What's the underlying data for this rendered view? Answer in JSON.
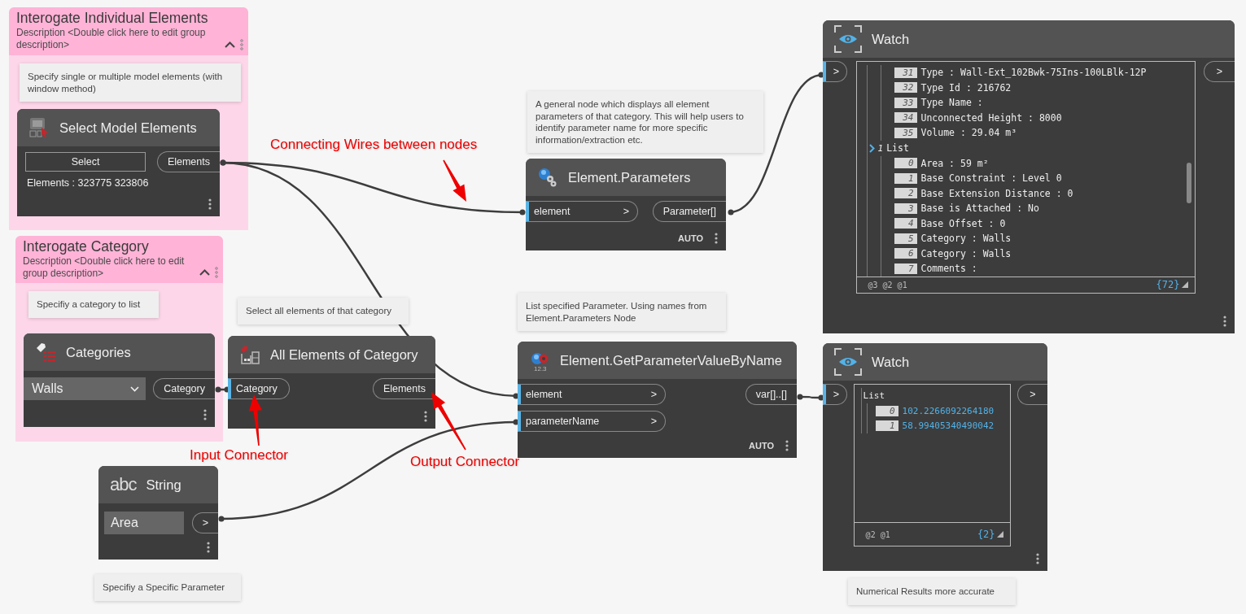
{
  "groups": [
    {
      "title": "Interogate Individual Elements",
      "description": "Description <Double click here to edit group description>"
    },
    {
      "title": "Interogate Category",
      "description": "Description <Double click here to edit group description>"
    }
  ],
  "notes": [
    {
      "text": "Specify single or multiple model elements (with window method)"
    },
    {
      "text": "Specifiy a category to list"
    },
    {
      "text": "Select all elements of that category"
    },
    {
      "text": "A general node which displays all element parameters of that category. This will help users to identify parameter name for more specific information/extraction etc."
    },
    {
      "text": "List specified Parameter. Using names from Element.Parameters Node"
    },
    {
      "text": "Specifiy a Specific Parameter"
    },
    {
      "text": "Numerical Results more accurate"
    }
  ],
  "nodes": [
    {
      "kind": "select",
      "title": "Select Model Elements",
      "button": "Select",
      "value": "Elements : 323775 323806",
      "outputs": [
        {
          "label": "Elements"
        }
      ]
    },
    {
      "kind": "dropdown",
      "title": "Categories",
      "value": "Walls",
      "outputs": [
        {
          "label": "Category"
        }
      ]
    },
    {
      "kind": "function",
      "title": "All Elements of Category",
      "inputs": [
        {
          "label": "Category"
        }
      ],
      "outputs": [
        {
          "label": "Elements"
        }
      ]
    },
    {
      "kind": "function",
      "title": "Element.Parameters",
      "inputs": [
        {
          "label": "element",
          "arrow": ">"
        }
      ],
      "outputs": [
        {
          "label": "Parameter[]"
        }
      ],
      "lacing": "AUTO"
    },
    {
      "kind": "function",
      "title": "Element.GetParameterValueByName",
      "icon_text": "12.3",
      "inputs": [
        {
          "label": "element",
          "arrow": ">"
        },
        {
          "label": "parameterName",
          "arrow": ">"
        }
      ],
      "outputs": [
        {
          "label": "var[]..[]"
        }
      ],
      "lacing": "AUTO"
    },
    {
      "kind": "string",
      "icon_text": "abc",
      "title": "String",
      "value": "Area",
      "outputs": [
        {
          "label": ">"
        }
      ]
    },
    {
      "kind": "watch",
      "title": "Watch",
      "inputs": [
        {
          "label": ">"
        }
      ],
      "outputs": [
        {
          "label": ">"
        }
      ],
      "lists": [
        {
          "items": [
            {
              "index": "31",
              "text": "Type : Wall-Ext_102Bwk-75Ins-100LBlk-12P",
              "kind": "text"
            },
            {
              "index": "32",
              "text": "Type Id : 216762",
              "kind": "text"
            },
            {
              "index": "33",
              "text": "Type Name :",
              "kind": "text"
            },
            {
              "index": "34",
              "text": "Unconnected Height : 8000",
              "kind": "text"
            },
            {
              "index": "35",
              "text": "Volume : 29.04 m³",
              "kind": "text"
            }
          ]
        },
        {
          "index": "1",
          "label": "List",
          "expanded": true,
          "items": [
            {
              "index": "0",
              "text": "Area : 59 m²",
              "kind": "text"
            },
            {
              "index": "1",
              "text": "Base Constraint : Level 0",
              "kind": "text"
            },
            {
              "index": "2",
              "text": "Base Extension Distance : 0",
              "kind": "text"
            },
            {
              "index": "3",
              "text": "Base is Attached : No",
              "kind": "text"
            },
            {
              "index": "4",
              "text": "Base Offset : 0",
              "kind": "text"
            },
            {
              "index": "5",
              "text": "Category : Walls",
              "kind": "text"
            },
            {
              "index": "6",
              "text": "Category : Walls",
              "kind": "text"
            },
            {
              "index": "7",
              "text": "Comments :",
              "kind": "text"
            }
          ]
        }
      ],
      "levels": "@3 @2 @1",
      "count": "{72}"
    },
    {
      "kind": "watch",
      "title": "Watch",
      "inputs": [
        {
          "label": ">"
        }
      ],
      "outputs": [
        {
          "label": ">"
        }
      ],
      "lists": [
        {
          "label": "List",
          "items": [
            {
              "index": "0",
              "text": "102.2266092264180",
              "kind": "number"
            },
            {
              "index": "1",
              "text": "58.99405340490042",
              "kind": "number"
            }
          ]
        }
      ],
      "levels": "@2 @1",
      "count": "{2}"
    }
  ],
  "annotations": [
    {
      "text": "Connecting Wires between nodes"
    },
    {
      "text": "Input Connector"
    },
    {
      "text": "Output Connector"
    }
  ]
}
